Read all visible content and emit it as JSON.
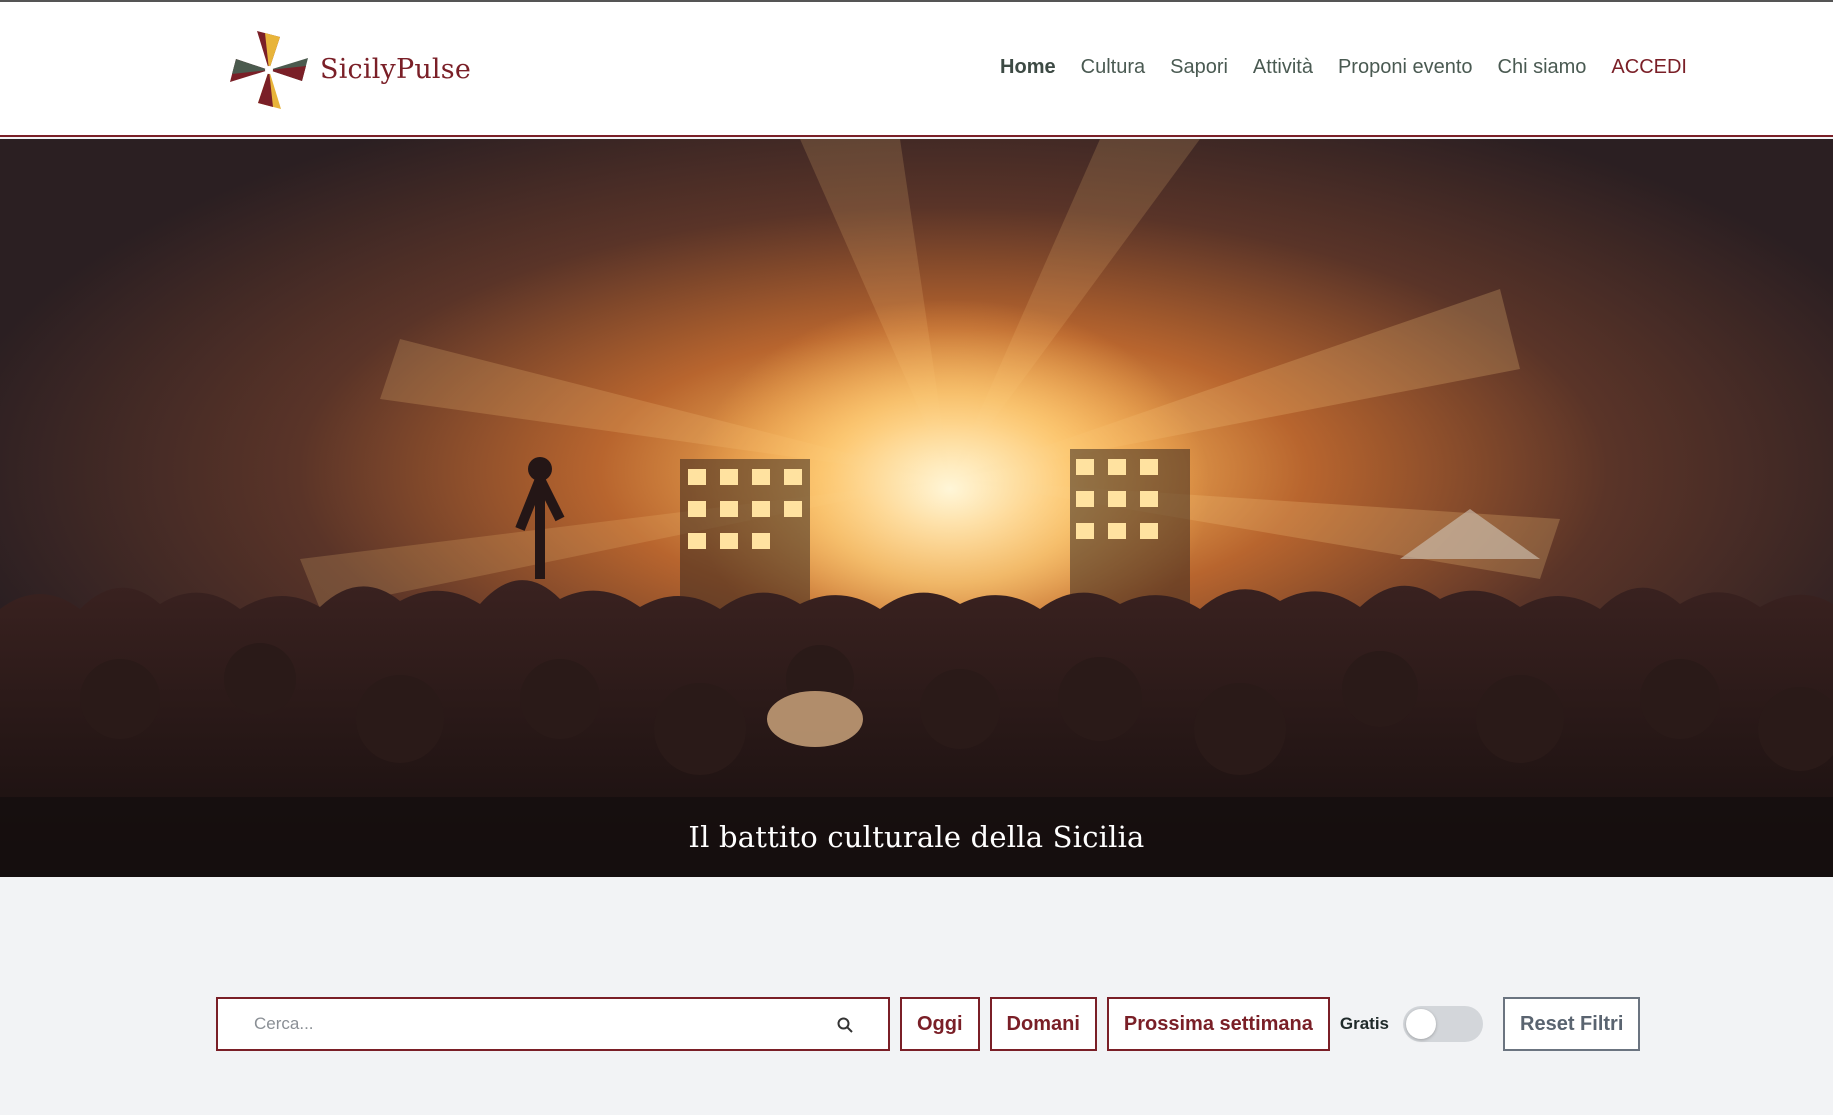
{
  "brand": {
    "name": "SicilyPulse"
  },
  "nav": {
    "items": [
      {
        "label": "Home",
        "active": true
      },
      {
        "label": "Cultura"
      },
      {
        "label": "Sapori"
      },
      {
        "label": "Attività"
      },
      {
        "label": "Proponi evento"
      },
      {
        "label": "Chi siamo"
      },
      {
        "label": "ACCEDI",
        "accent": true
      }
    ]
  },
  "hero": {
    "caption": "Il battito culturale della Sicilia"
  },
  "filters": {
    "search_placeholder": "Cerca...",
    "search_icon": "search-icon",
    "chips": [
      "Oggi",
      "Domani",
      "Prossima settimana"
    ],
    "gratis_label": "Gratis",
    "gratis_enabled": false,
    "reset_label": "Reset Filtri"
  },
  "colors": {
    "accent": "#7a1f27",
    "background": "#f2f3f5",
    "nav_text": "#4a5a52"
  }
}
